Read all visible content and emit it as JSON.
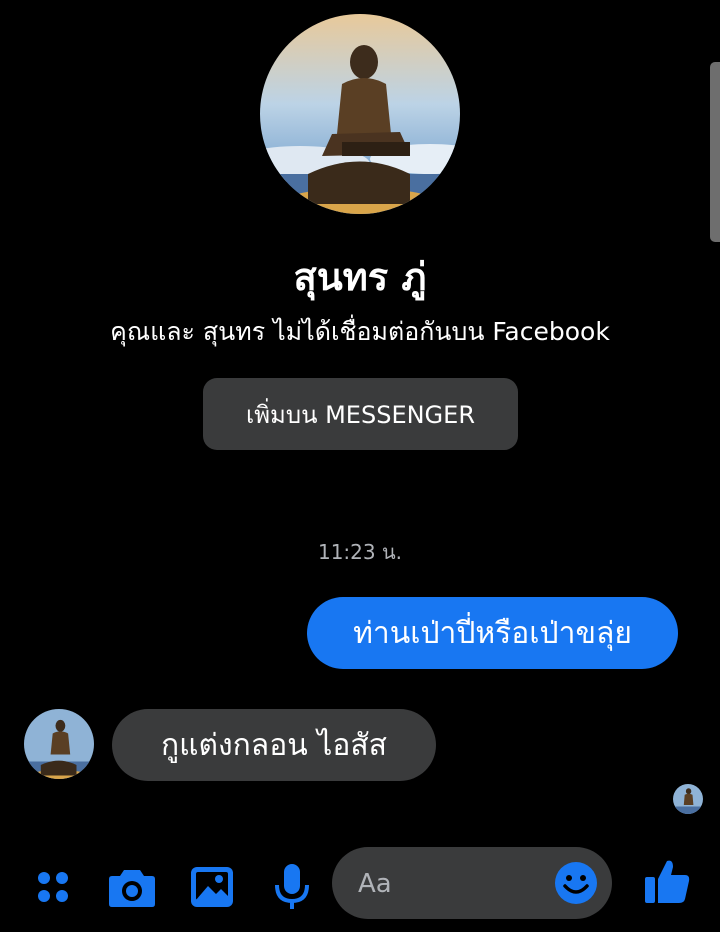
{
  "contact": {
    "name": "สุนทร ภู่",
    "connection_note": "คุณและ สุนทร ไม่ได้เชื่อมต่อกันบน Facebook",
    "add_button_label": "เพิ่มบน MESSENGER"
  },
  "conversation": {
    "timestamp": "11:23 น.",
    "messages": [
      {
        "direction": "sent",
        "text": "ท่านเป่าปี่หรือเป่าขลุ่ย"
      },
      {
        "direction": "received",
        "text": "กูแต่งกลอน ไอสัส"
      }
    ]
  },
  "composer": {
    "placeholder": "Aa"
  },
  "toolbar": {
    "icons": [
      "apps-icon",
      "camera-icon",
      "gallery-icon",
      "microphone-icon",
      "emoji-icon",
      "like-icon"
    ]
  },
  "colors": {
    "background": "#000000",
    "accent": "#1877f2",
    "bubble_gray": "#3a3b3c",
    "timestamp": "#b0b3b8"
  }
}
